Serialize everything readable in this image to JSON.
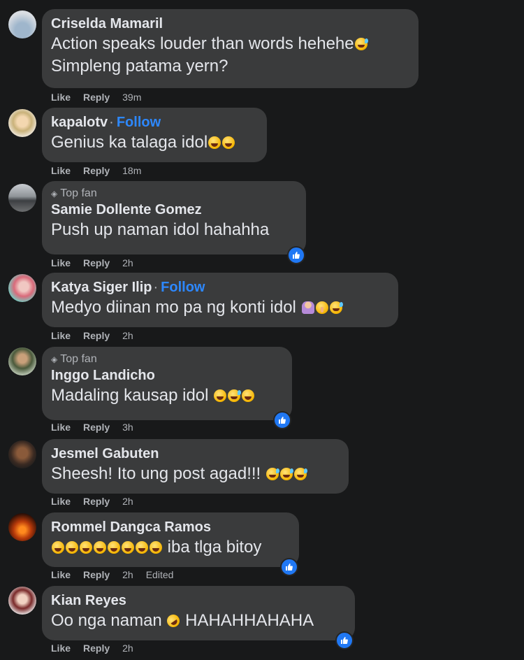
{
  "comments": [
    {
      "name": "Criselda Mamaril",
      "lines": [
        "Action speaks louder than words hehehe",
        "Simpleng patama yern?"
      ],
      "like": "Like",
      "reply": "Reply",
      "time": "39m"
    },
    {
      "name": "kapalotv",
      "follow": "Follow",
      "lines": [
        "Genius ka talaga idol"
      ],
      "like": "Like",
      "reply": "Reply",
      "time": "18m"
    },
    {
      "badge": "Top fan",
      "name": "Samie Dollente Gomez",
      "lines": [
        "Push up naman idol hahahha"
      ],
      "like": "Like",
      "reply": "Reply",
      "time": "2h",
      "reaction": "like-reaction"
    },
    {
      "name": "Katya Siger Ilip",
      "follow": "Follow",
      "lines": [
        "Medyo diinan mo pa ng konti idol"
      ],
      "like": "Like",
      "reply": "Reply",
      "time": "2h"
    },
    {
      "badge": "Top fan",
      "name": "Inggo Landicho",
      "lines": [
        "Madaling kausap idol"
      ],
      "like": "Like",
      "reply": "Reply",
      "time": "3h",
      "reaction": "like-reaction"
    },
    {
      "name": "Jesmel Gabuten",
      "lines": [
        "Sheesh! Ito ung post agad!!!"
      ],
      "like": "Like",
      "reply": "Reply",
      "time": "2h"
    },
    {
      "name": "Rommel Dangca Ramos",
      "lines": [
        "iba tlga bitoy"
      ],
      "like": "Like",
      "reply": "Reply",
      "time": "2h",
      "edited": "Edited",
      "reaction": "like-reaction"
    },
    {
      "name": "Kian Reyes",
      "lines": [
        "Oo nga naman",
        "HAHAHHAHAHA"
      ],
      "like": "Like",
      "reply": "Reply",
      "time": "2h",
      "reaction": "like-reaction"
    }
  ],
  "colors": {
    "background": "#18191a",
    "bubble": "#3a3b3c",
    "link": "#2d88ff",
    "reaction": "#2078f4"
  }
}
